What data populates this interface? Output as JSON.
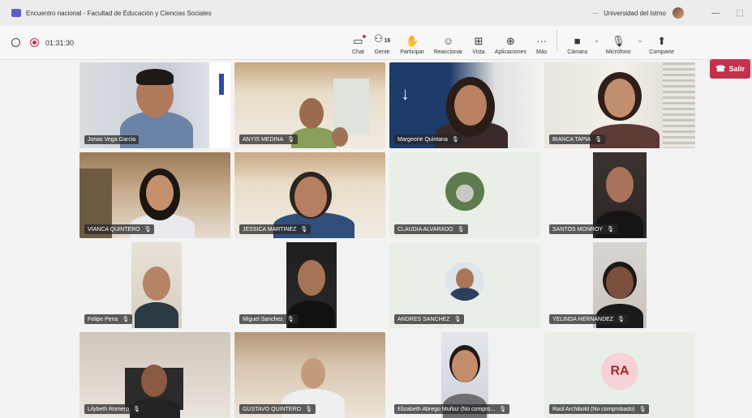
{
  "window": {
    "title": "Encuentro nacional - Facultad de Educación y Ciencias Sociales",
    "more": "···",
    "org": "Universidad del Istmo",
    "minimize": "—",
    "restore": "⬚"
  },
  "toolbar": {
    "timer": "01:31:30",
    "chat": "Chat",
    "people": "Gente",
    "people_count": "16",
    "raise": "Participar",
    "react": "Reaccionar",
    "view": "Vista",
    "apps": "Aplicaciones",
    "more": "Más",
    "camera": "Cámara",
    "mic": "Micrófono",
    "share": "Comparte",
    "leave": "Salir"
  },
  "participants": [
    {
      "name": "Jonas Vega Garcia"
    },
    {
      "name": "ANYIS MEDINA"
    },
    {
      "name": "Margeorie Quintana"
    },
    {
      "name": "BIANCA TAPIA"
    },
    {
      "name": "VIANCA QUINTERO"
    },
    {
      "name": "JESSICA MARTINEZ"
    },
    {
      "name": "CLAUDIA ALVARADO"
    },
    {
      "name": "SANTOS MONROY"
    },
    {
      "name": "Felipe Pena"
    },
    {
      "name": "Miguel Sanchez"
    },
    {
      "name": "ANDRES SANCHEZ"
    },
    {
      "name": "YELINDA HERNANDEZ"
    },
    {
      "name": "Lilybeth Romero"
    },
    {
      "name": "GUSTAVO QUINTERO"
    },
    {
      "name": "Elizabeth Abrego Muñoz (No compro..."
    },
    {
      "name": "Raúl Archibold (No comprobado)",
      "initials": "RA"
    }
  ]
}
